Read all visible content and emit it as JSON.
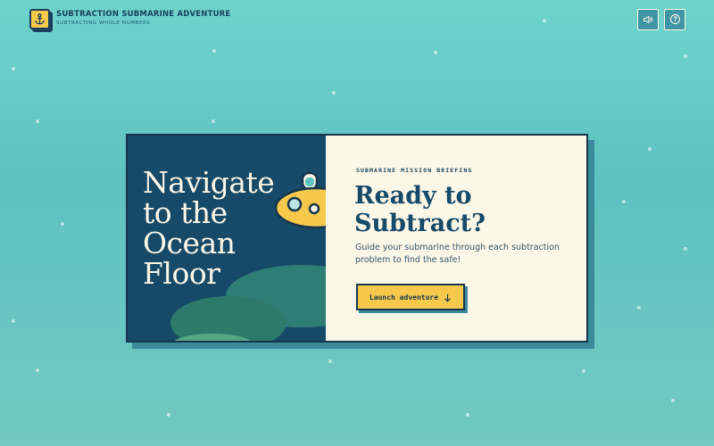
{
  "header": {
    "title": "SUBTRACTION SUBMARINE ADVENTURE",
    "subtitle": "SUBTRACTING WHOLE NUMBERS",
    "logo_icon": "anchor-icon",
    "sound_icon": "volume-icon",
    "help_icon": "help-circle-icon"
  },
  "card": {
    "left_heading": "Navigate to the Ocean Floor",
    "eyebrow": "SUBMARINE MISSION BRIEFING",
    "title": "Ready to Subtract?",
    "description": "Guide your submarine through each subtraction problem to find the safe!",
    "launch_label": "Launch adventure",
    "launch_icon": "arrow-down-icon",
    "illustration": "submarine-icon"
  },
  "colors": {
    "navy": "#164a68",
    "accent_yellow": "#f6c94c",
    "cream": "#fdf7e8",
    "teal": "#5ec2c0"
  }
}
